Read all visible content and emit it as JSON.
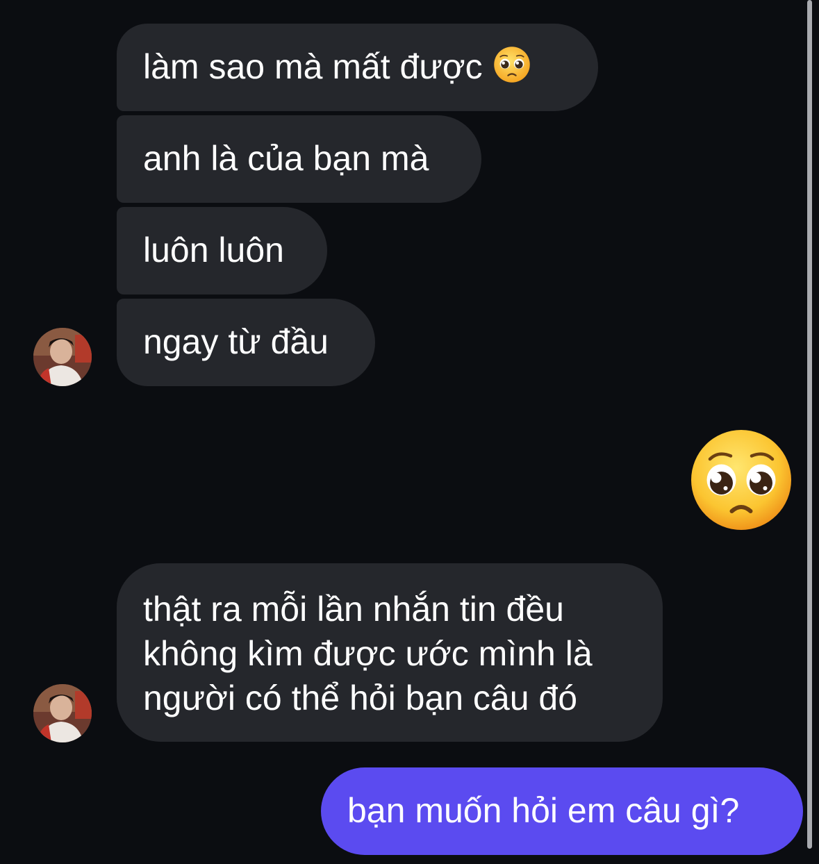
{
  "messages": [
    {
      "sender": "other",
      "text": "làm sao mà mất được",
      "emoji_icon": "pleading-face-icon"
    },
    {
      "sender": "other",
      "text": "anh là của bạn mà"
    },
    {
      "sender": "other",
      "text": "luôn luôn"
    },
    {
      "sender": "other",
      "text": "ngay từ đầu"
    },
    {
      "sender": "self",
      "emoji_icon": "pleading-face-icon"
    },
    {
      "sender": "other",
      "lines": [
        "thật ra mỗi lần nhắn tin đều",
        "không kìm được ước mình là",
        "người có thể hỏi bạn câu đó"
      ]
    },
    {
      "sender": "self",
      "text": "bạn muốn hỏi em câu gì?"
    }
  ],
  "colors": {
    "background": "#0b0d11",
    "incoming_bubble": "#25272c",
    "outgoing_bubble": "#5b4bf0",
    "text": "#ffffff"
  },
  "avatar_icon": "contact-avatar"
}
